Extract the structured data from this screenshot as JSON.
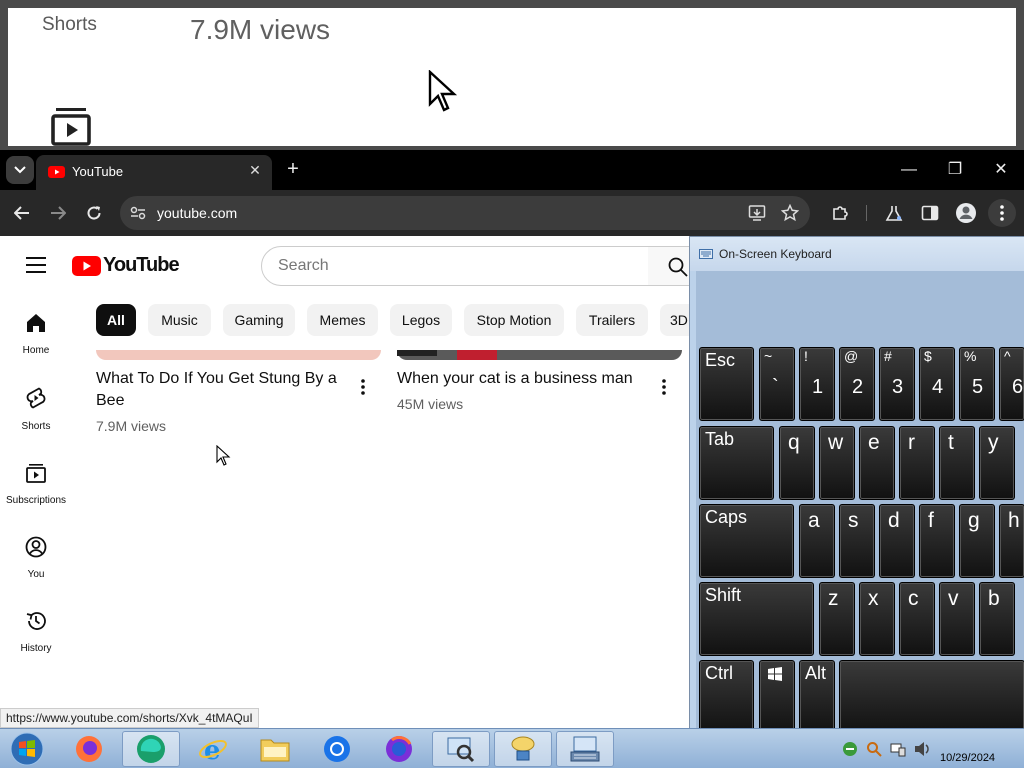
{
  "zoom_strip": {
    "shorts_label": "Shorts",
    "views_text": "7.9M views"
  },
  "browser": {
    "tab_title": "YouTube",
    "url": "youtube.com"
  },
  "youtube": {
    "logo_text": "YouTube",
    "search_placeholder": "Search",
    "sidebar": [
      {
        "label": "Home"
      },
      {
        "label": "Shorts"
      },
      {
        "label": "Subscriptions"
      },
      {
        "label": "You"
      },
      {
        "label": "History"
      }
    ],
    "chips": [
      "All",
      "Music",
      "Gaming",
      "Memes",
      "Legos",
      "Stop Motion",
      "Trailers",
      "3D"
    ],
    "videos": [
      {
        "title_line1": "What To Do If You Get Stung By a",
        "title_line2": "Bee",
        "views": "7.9M views"
      },
      {
        "title_line1": "When your cat is a business man",
        "title_line2": "",
        "views": "45M views"
      }
    ],
    "status_url": "https://www.youtube.com/shorts/Xvk_4tMAQuI"
  },
  "osk": {
    "title": "On-Screen Keyboard",
    "row1": [
      {
        "label": "Esc"
      },
      {
        "top": "~",
        "bottom": "`"
      },
      {
        "top": "!",
        "bottom": "1"
      },
      {
        "top": "@",
        "bottom": "2"
      },
      {
        "top": "#",
        "bottom": "3"
      },
      {
        "top": "$",
        "bottom": "4"
      },
      {
        "top": "%",
        "bottom": "5"
      },
      {
        "top": "^",
        "bottom": "6"
      }
    ],
    "row2": [
      "Tab",
      "q",
      "w",
      "e",
      "r",
      "t",
      "y"
    ],
    "row3": [
      "Caps",
      "a",
      "s",
      "d",
      "f",
      "g",
      "h"
    ],
    "row4": [
      "Shift",
      "z",
      "x",
      "c",
      "v",
      "b"
    ],
    "row5": [
      "Ctrl",
      "Alt"
    ]
  },
  "taskbar": {
    "date": "10/29/2024"
  },
  "colors": {
    "youtube_red": "#ff0000",
    "chrome_dark": "#282828"
  }
}
